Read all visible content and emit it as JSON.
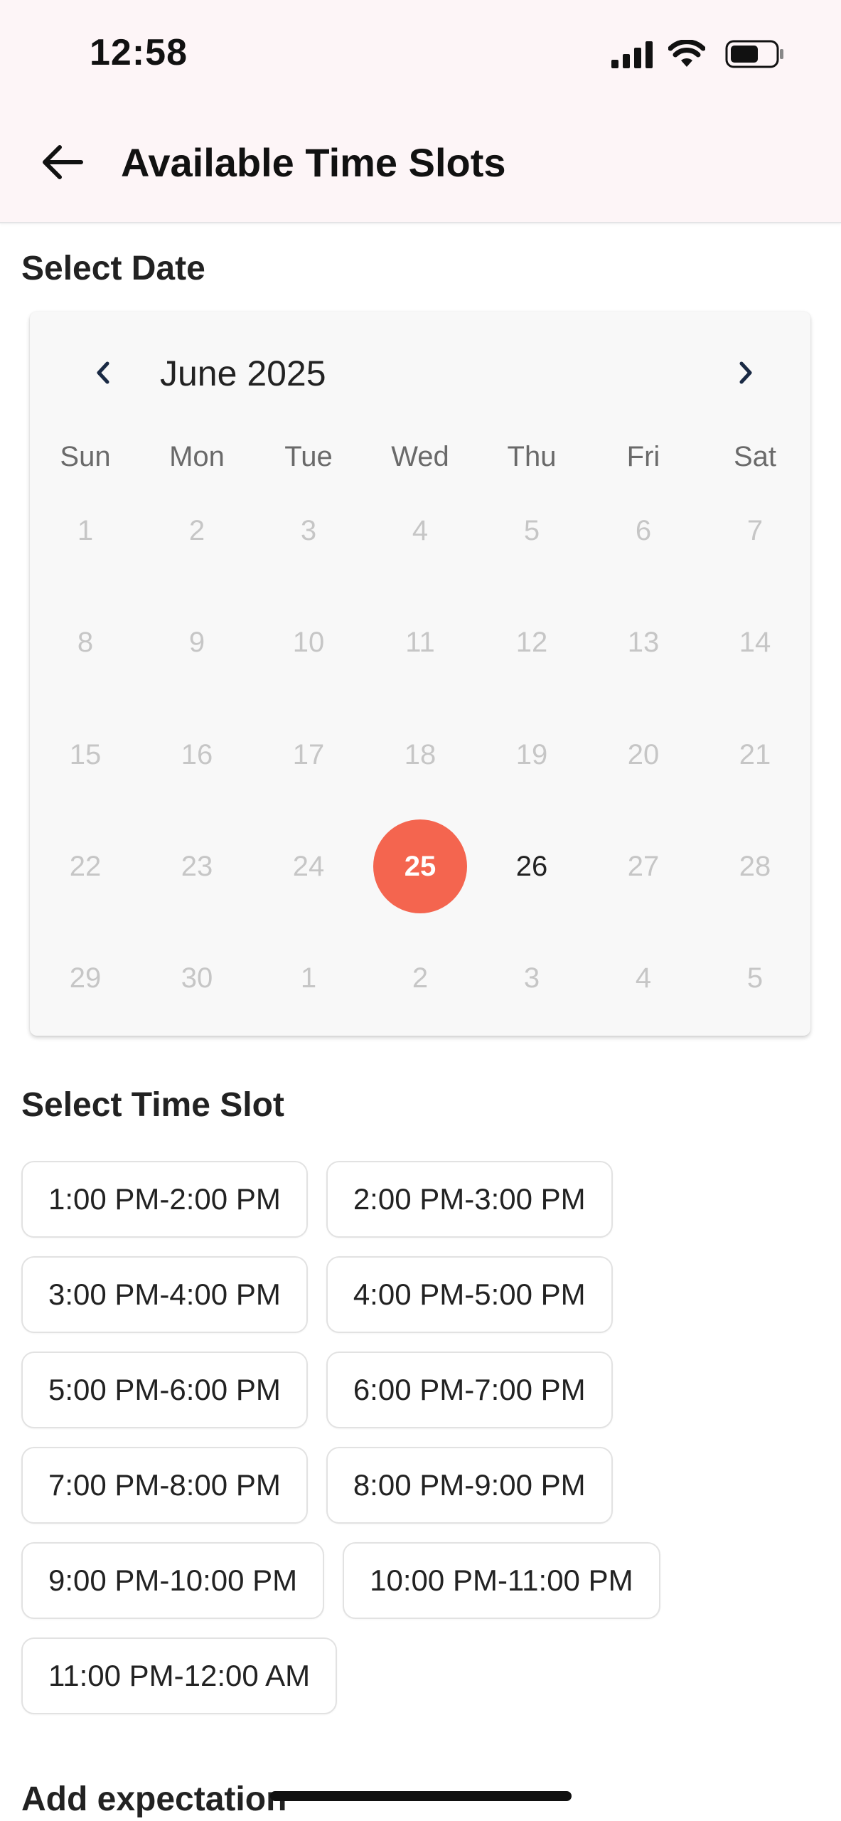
{
  "status_bar": {
    "time": "12:58",
    "icons": [
      "cellular-signal-icon",
      "wifi-icon",
      "battery-icon"
    ]
  },
  "header": {
    "back_icon": "arrow-left-icon",
    "title": "Available Time Slots",
    "background": "#fdf5f7"
  },
  "date_section": {
    "title": "Select Date"
  },
  "calendar": {
    "month_label": "June 2025",
    "prev_icon": "chevron-left-icon",
    "next_icon": "chevron-right-icon",
    "weekdays": [
      "Sun",
      "Mon",
      "Tue",
      "Wed",
      "Thu",
      "Fri",
      "Sat"
    ],
    "weeks": [
      [
        {
          "d": "1",
          "s": "disabled"
        },
        {
          "d": "2",
          "s": "disabled"
        },
        {
          "d": "3",
          "s": "disabled"
        },
        {
          "d": "4",
          "s": "disabled"
        },
        {
          "d": "5",
          "s": "disabled"
        },
        {
          "d": "6",
          "s": "disabled"
        },
        {
          "d": "7",
          "s": "disabled"
        }
      ],
      [
        {
          "d": "8",
          "s": "disabled"
        },
        {
          "d": "9",
          "s": "disabled"
        },
        {
          "d": "10",
          "s": "disabled"
        },
        {
          "d": "11",
          "s": "disabled"
        },
        {
          "d": "12",
          "s": "disabled"
        },
        {
          "d": "13",
          "s": "disabled"
        },
        {
          "d": "14",
          "s": "disabled"
        }
      ],
      [
        {
          "d": "15",
          "s": "disabled"
        },
        {
          "d": "16",
          "s": "disabled"
        },
        {
          "d": "17",
          "s": "disabled"
        },
        {
          "d": "18",
          "s": "disabled"
        },
        {
          "d": "19",
          "s": "disabled"
        },
        {
          "d": "20",
          "s": "disabled"
        },
        {
          "d": "21",
          "s": "disabled"
        }
      ],
      [
        {
          "d": "22",
          "s": "disabled"
        },
        {
          "d": "23",
          "s": "disabled"
        },
        {
          "d": "24",
          "s": "disabled"
        },
        {
          "d": "25",
          "s": "selected"
        },
        {
          "d": "26",
          "s": "available"
        },
        {
          "d": "27",
          "s": "disabled"
        },
        {
          "d": "28",
          "s": "disabled"
        }
      ],
      [
        {
          "d": "29",
          "s": "disabled"
        },
        {
          "d": "30",
          "s": "disabled"
        },
        {
          "d": "1",
          "s": "disabled"
        },
        {
          "d": "2",
          "s": "disabled"
        },
        {
          "d": "3",
          "s": "disabled"
        },
        {
          "d": "4",
          "s": "disabled"
        },
        {
          "d": "5",
          "s": "disabled"
        }
      ]
    ],
    "selected_color": "#f4654f"
  },
  "time_section": {
    "title": "Select Time Slot"
  },
  "time_slots": [
    [
      "1:00 PM-2:00 PM",
      "2:00 PM-3:00 PM"
    ],
    [
      "3:00 PM-4:00 PM",
      "4:00 PM-5:00 PM"
    ],
    [
      "5:00 PM-6:00 PM",
      "6:00 PM-7:00 PM"
    ],
    [
      "7:00 PM-8:00 PM",
      "8:00 PM-9:00 PM"
    ],
    [
      "9:00 PM-10:00 PM",
      "10:00 PM-11:00 PM"
    ],
    [
      "11:00 PM-12:00 AM"
    ]
  ],
  "expectation_section": {
    "title": "Add expectation"
  }
}
